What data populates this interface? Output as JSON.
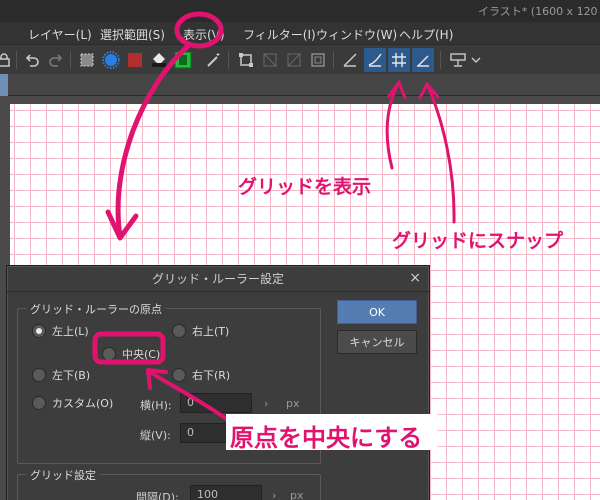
{
  "window": {
    "title": "イラスト* (1600 x 120"
  },
  "menu": {
    "items": [
      "レイヤー(L)",
      "選択範囲(S)",
      "表示(V)",
      "フィルター(I)",
      "ウィンドウ(W)",
      "ヘルプ(H)"
    ]
  },
  "toolbar": {
    "icons": [
      "lock-icon",
      "undo-icon",
      "redo-icon",
      "select-all-icon",
      "deselect-icon",
      "fill-color-icon",
      "bucket-icon",
      "green-square-icon",
      "magic-wand-icon",
      "transform-icon",
      "grid-off-icon",
      "crop-icon",
      "frame-icon",
      "ruler-icon",
      "snap-ruler-icon",
      "grid-icon",
      "snap-grid-icon",
      "stamp-icon",
      "dropdown-icon"
    ]
  },
  "dialog": {
    "title": "グリッド・ルーラー設定",
    "close": "×",
    "origin_group": {
      "label": "グリッド・ルーラーの原点",
      "options": [
        "左上(L)",
        "右上(T)",
        "中央(C)",
        "左下(B)",
        "右下(R)",
        "カスタム(O)"
      ],
      "selected": "左上(L)"
    },
    "horizontal": {
      "label": "横(H):",
      "value": "0",
      "unit": "px"
    },
    "vertical": {
      "label": "縦(V):",
      "value": "0",
      "unit": "px"
    },
    "grid_group": {
      "label": "グリッド設定",
      "interval_label": "間隔(D):",
      "interval_value": "100",
      "unit": "px"
    },
    "ok": "OK",
    "cancel": "キャンセル"
  },
  "annotations": {
    "show_grid": "グリッドを表示",
    "snap_grid": "グリッドにスナップ",
    "set_center": "原点を中央にする",
    "color": "#e0146e"
  }
}
